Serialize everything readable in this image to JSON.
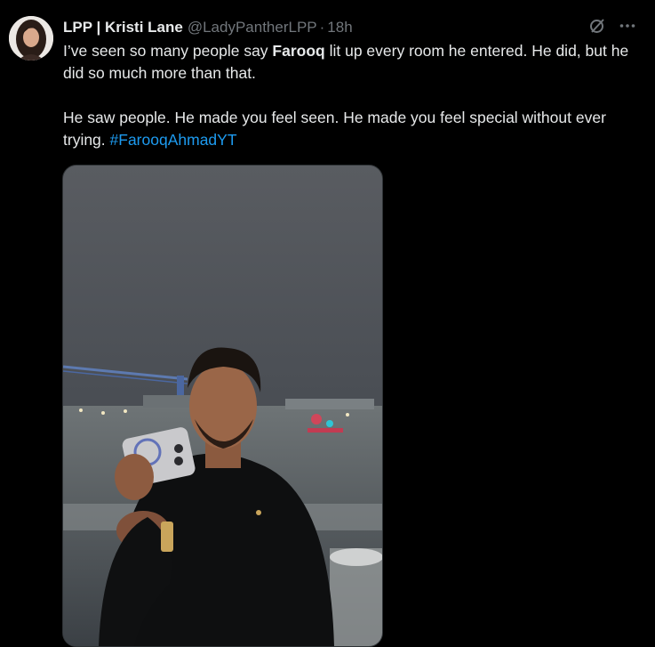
{
  "tweet": {
    "author_name": "LPP | Kristi Lane",
    "author_handle": "@LadyPantherLPP",
    "separator": "·",
    "timestamp": "18h",
    "text_line1_before": "I’ve seen so many people say ",
    "text_line1_bold": "Farooq",
    "text_line1_after": " lit up every room he entered. He did, but he did so much more than that.",
    "text_para2": "He saw people. He made you feel seen. He made you feel special without ever trying. ",
    "hashtag": "#FarooqAhmadYT"
  },
  "icons": {
    "grok": "grok-icon",
    "more": "more-icon",
    "avatar": "avatar-photo",
    "media": "video-still-photo"
  },
  "colors": {
    "background": "#000000",
    "text": "#e7e9ea",
    "muted": "#71767b",
    "link": "#1d9bf0"
  }
}
